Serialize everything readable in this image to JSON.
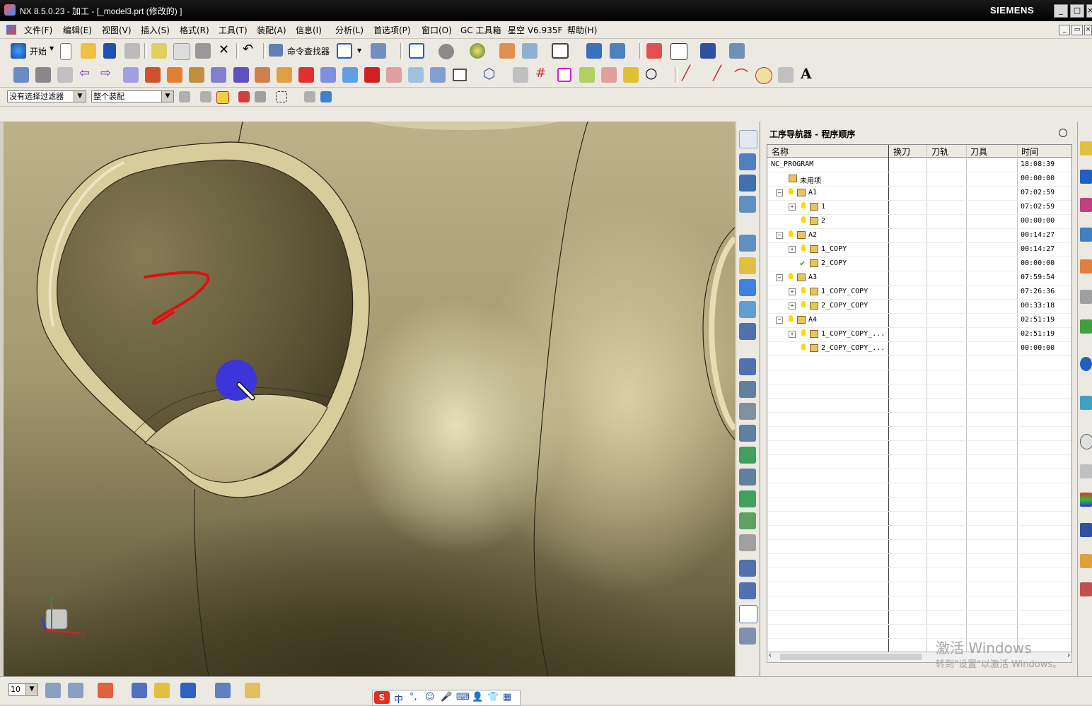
{
  "window": {
    "title": "NX 8.5.0.23 - 加工 - [_model3.prt (修改的) ]",
    "brand": "SIEMENS",
    "minimize": "_",
    "maximize": "□",
    "close": "×"
  },
  "menu": {
    "items": [
      "文件(F)",
      "编辑(E)",
      "视图(V)",
      "插入(S)",
      "格式(R)",
      "工具(T)",
      "装配(A)",
      "信息(I)",
      "分析(L)",
      "首选项(P)",
      "窗口(O)",
      "GC 工具箱",
      "星空 V6.935F",
      "帮助(H)"
    ]
  },
  "toolbar1": {
    "start_label": "开始",
    "command_finder_label": "命令查找器"
  },
  "filters": {
    "selection_filter": "没有选择过滤器",
    "scope": "整个装配"
  },
  "navigator": {
    "title": "工序导航器 - 程序顺序",
    "columns": [
      "名称",
      "换刀",
      "刀轨",
      "刀具",
      "时间"
    ],
    "rows": [
      {
        "name": "NC_PROGRAM",
        "time": "18:08:39",
        "level": 0,
        "bulb": false,
        "check": false,
        "expander": "",
        "folder": false
      },
      {
        "name": "未用项",
        "time": "00:00:00",
        "level": 1,
        "bulb": false,
        "check": false,
        "expander": "",
        "folder": true
      },
      {
        "name": "A1",
        "time": "07:02:59",
        "level": 1,
        "bulb": true,
        "check": false,
        "expander": "−",
        "folder": true
      },
      {
        "name": "1",
        "time": "07:02:59",
        "level": 2,
        "bulb": true,
        "check": false,
        "expander": "+",
        "folder": true
      },
      {
        "name": "2",
        "time": "00:00:00",
        "level": 2,
        "bulb": true,
        "check": false,
        "expander": "",
        "folder": true
      },
      {
        "name": "A2",
        "time": "00:14:27",
        "level": 1,
        "bulb": true,
        "check": false,
        "expander": "−",
        "folder": true
      },
      {
        "name": "1_COPY",
        "time": "00:14:27",
        "level": 2,
        "bulb": true,
        "check": false,
        "expander": "+",
        "folder": true
      },
      {
        "name": "2_COPY",
        "time": "00:00:00",
        "level": 2,
        "bulb": false,
        "check": true,
        "expander": "",
        "folder": true
      },
      {
        "name": "A3",
        "time": "07:59:54",
        "level": 1,
        "bulb": true,
        "check": false,
        "expander": "−",
        "folder": true
      },
      {
        "name": "1_COPY_COPY",
        "time": "07:26:36",
        "level": 2,
        "bulb": true,
        "check": false,
        "expander": "+",
        "folder": true
      },
      {
        "name": "2_COPY_COPY",
        "time": "00:33:18",
        "level": 2,
        "bulb": true,
        "check": false,
        "expander": "+",
        "folder": true
      },
      {
        "name": "A4",
        "time": "02:51:19",
        "level": 1,
        "bulb": true,
        "check": false,
        "expander": "−",
        "folder": true
      },
      {
        "name": "1_COPY_COPY_...",
        "time": "02:51:19",
        "level": 2,
        "bulb": true,
        "check": false,
        "expander": "+",
        "folder": true
      },
      {
        "name": "2_COPY_COPY_...",
        "time": "00:00:00",
        "level": 2,
        "bulb": true,
        "check": false,
        "expander": "",
        "folder": true
      }
    ]
  },
  "bottom": {
    "layer_value": "10",
    "ime": [
      "中",
      "°,",
      "☺",
      "🎤",
      "⌨",
      "👤",
      "👕",
      "▦"
    ]
  },
  "watermark": {
    "line1": "激活 Windows",
    "line2": "转到\"设置\"以激活 Windows。"
  },
  "colors": {
    "model_surface": "#b5ab7f",
    "tool_marker": "#3a36d8",
    "annotation": "#e01010"
  }
}
